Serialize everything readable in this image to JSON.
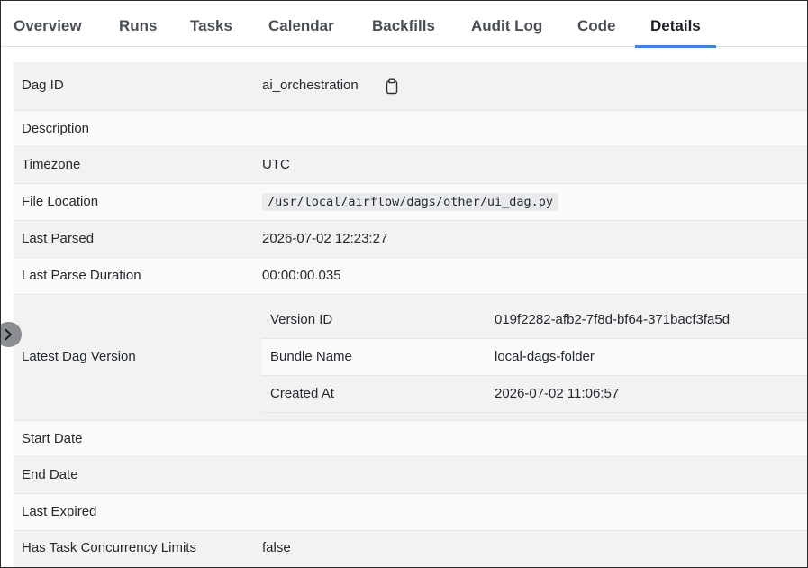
{
  "tabs": [
    {
      "label": "Overview"
    },
    {
      "label": "Runs"
    },
    {
      "label": "Tasks"
    },
    {
      "label": "Calendar"
    },
    {
      "label": "Backfills"
    },
    {
      "label": "Audit Log"
    },
    {
      "label": "Code"
    },
    {
      "label": "Details"
    }
  ],
  "active_tab": "Details",
  "details": {
    "dag_id": {
      "label": "Dag ID",
      "value": "ai_orchestration"
    },
    "description": {
      "label": "Description",
      "value": ""
    },
    "timezone": {
      "label": "Timezone",
      "value": "UTC"
    },
    "file_location": {
      "label": "File Location",
      "value": "/usr/local/airflow/dags/other/ui_dag.py"
    },
    "last_parsed": {
      "label": "Last Parsed",
      "value": "2026-07-02 12:23:27"
    },
    "last_parse_duration": {
      "label": "Last Parse Duration",
      "value": "00:00:00.035"
    },
    "latest_dag_version": {
      "label": "Latest Dag Version",
      "version_id": {
        "label": "Version ID",
        "value": "019f2282-afb2-7f8d-bf64-371bacf3fa5d"
      },
      "bundle_name": {
        "label": "Bundle Name",
        "value": "local-dags-folder"
      },
      "created_at": {
        "label": "Created At",
        "value": "2026-07-02 11:06:57"
      }
    },
    "start_date": {
      "label": "Start Date",
      "value": ""
    },
    "end_date": {
      "label": "End Date",
      "value": ""
    },
    "last_expired": {
      "label": "Last Expired",
      "value": ""
    },
    "has_task_concurrency_limits": {
      "label": "Has Task Concurrency Limits",
      "value": "false"
    }
  },
  "icons": {
    "copy": "clipboard-icon",
    "side_toggle": "chevron-right-icon"
  },
  "colors": {
    "active_tab_underline": "#3a86d9",
    "row_shade": "#f2f2f3",
    "row_plain": "#fafafa",
    "code_bg": "#e9eaec",
    "toggle_bg": "#8a8d91"
  }
}
